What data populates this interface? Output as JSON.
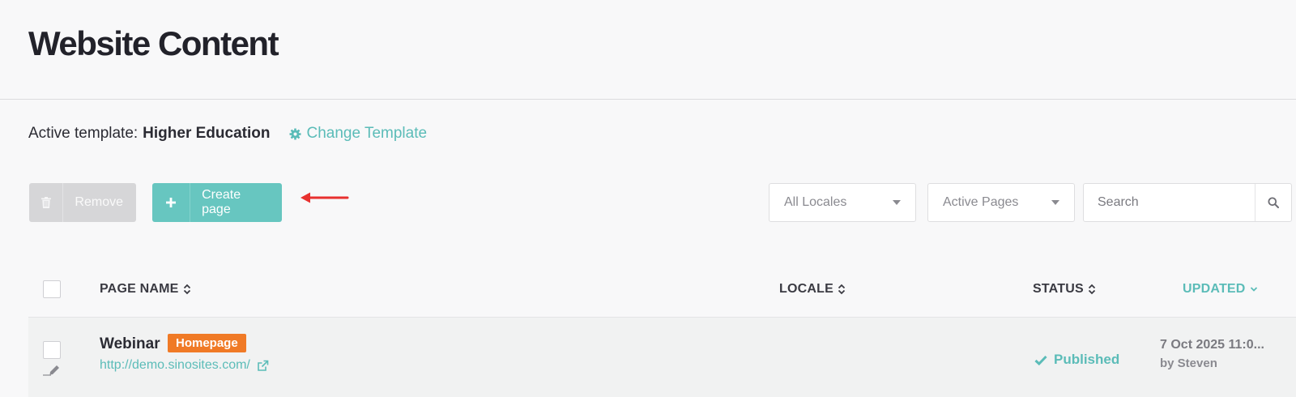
{
  "header": {
    "title": "Website Content"
  },
  "template": {
    "label": "Active template:",
    "name": "Higher Education",
    "change_label": "Change Template"
  },
  "toolbar": {
    "remove_label": "Remove",
    "create_label": "Create page"
  },
  "filters": {
    "locale": {
      "selected": "All Locales"
    },
    "pages": {
      "selected": "Active Pages"
    },
    "search": {
      "placeholder": "Search",
      "value": ""
    }
  },
  "table": {
    "columns": {
      "page_name": "PAGE NAME",
      "locale": "LOCALE",
      "status": "STATUS",
      "updated": "UPDATED"
    },
    "rows": [
      {
        "name": "Webinar",
        "badge": "Homepage",
        "url": "http://demo.sinosites.com/",
        "locale": "",
        "status": "Published",
        "updated_date": "7 Oct 2025 11:0...",
        "updated_by": "by Steven"
      }
    ]
  },
  "colors": {
    "accent": "#5bbcb8",
    "create_button": "#67c6c0",
    "badge": "#f07a26",
    "annotation_arrow": "#e8312f"
  },
  "icons": {
    "gear": "gear-icon",
    "trash": "trash-icon",
    "plus": "plus-icon",
    "search": "search-icon",
    "sort": "sort-icon",
    "external_link": "external-link-icon",
    "check": "check-icon",
    "pencil": "pencil-icon"
  }
}
